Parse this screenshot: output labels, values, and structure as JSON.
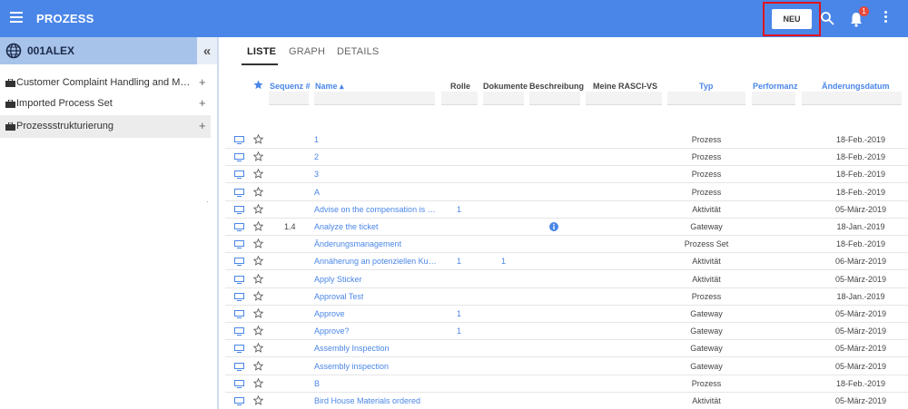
{
  "header": {
    "title": "PROZESS",
    "new_button": "NEU",
    "notification_count": "1",
    "colors": {
      "bar": "#4a86e8",
      "highlight": "#e0141e"
    }
  },
  "sidebar": {
    "workspace": "001ALEX",
    "collapse": "«",
    "items": [
      {
        "label": "Customer Complaint Handling and Managem...",
        "action": "+"
      },
      {
        "label": "Imported Process Set",
        "action": "+"
      },
      {
        "label": "Prozessstrukturierung",
        "action": "+"
      }
    ]
  },
  "tabs": [
    "LISTE",
    "GRAPH",
    "DETAILS"
  ],
  "table": {
    "columns": {
      "sequence": "Sequenz #",
      "name": "Name ▴",
      "role": "Rolle",
      "documents": "Dokumente",
      "description": "Beschreibung",
      "rasci": "Meine RASCI-VS",
      "type": "Typ",
      "performance": "Performanz",
      "changed": "Änderungsdatum"
    },
    "rows": [
      {
        "seq": "",
        "name": "1",
        "role": "",
        "docs": "",
        "info": false,
        "type": "Prozess",
        "date": "18-Feb.-2019"
      },
      {
        "seq": "",
        "name": "2",
        "role": "",
        "docs": "",
        "info": false,
        "type": "Prozess",
        "date": "18-Feb.-2019"
      },
      {
        "seq": "",
        "name": "3",
        "role": "",
        "docs": "",
        "info": false,
        "type": "Prozess",
        "date": "18-Feb.-2019"
      },
      {
        "seq": "",
        "name": "A",
        "role": "",
        "docs": "",
        "info": false,
        "type": "Prozess",
        "date": "18-Feb.-2019"
      },
      {
        "seq": "",
        "name": "Advise on the compensation is le...",
        "role": "1",
        "docs": "",
        "info": false,
        "type": "Aktivität",
        "date": "05-März-2019"
      },
      {
        "seq": "1.4",
        "name": "Analyze the ticket",
        "role": "",
        "docs": "",
        "info": true,
        "type": "Gateway",
        "date": "18-Jan.-2019"
      },
      {
        "seq": "",
        "name": "Änderungsmanagement",
        "role": "",
        "docs": "",
        "info": false,
        "type": "Prozess Set",
        "date": "18-Feb.-2019"
      },
      {
        "seq": "",
        "name": "Annäherung an potenziellen Kun...",
        "role": "1",
        "docs": "1",
        "info": false,
        "type": "Aktivität",
        "date": "06-März-2019"
      },
      {
        "seq": "",
        "name": "Apply Sticker",
        "role": "",
        "docs": "",
        "info": false,
        "type": "Aktivität",
        "date": "05-März-2019"
      },
      {
        "seq": "",
        "name": "Approval Test",
        "role": "",
        "docs": "",
        "info": false,
        "type": "Prozess",
        "date": "18-Jan.-2019"
      },
      {
        "seq": "",
        "name": "Approve",
        "role": "1",
        "docs": "",
        "info": false,
        "type": "Gateway",
        "date": "05-März-2019"
      },
      {
        "seq": "",
        "name": "Approve?",
        "role": "1",
        "docs": "",
        "info": false,
        "type": "Gateway",
        "date": "05-März-2019"
      },
      {
        "seq": "",
        "name": "Assembly Inspection",
        "role": "",
        "docs": "",
        "info": false,
        "type": "Gateway",
        "date": "05-März-2019"
      },
      {
        "seq": "",
        "name": "Assembly inspection",
        "role": "",
        "docs": "",
        "info": false,
        "type": "Gateway",
        "date": "05-März-2019"
      },
      {
        "seq": "",
        "name": "B",
        "role": "",
        "docs": "",
        "info": false,
        "type": "Prozess",
        "date": "18-Feb.-2019"
      },
      {
        "seq": "",
        "name": "Bird House Materials ordered",
        "role": "",
        "docs": "",
        "info": false,
        "type": "Aktivität",
        "date": "05-März-2019"
      }
    ]
  }
}
